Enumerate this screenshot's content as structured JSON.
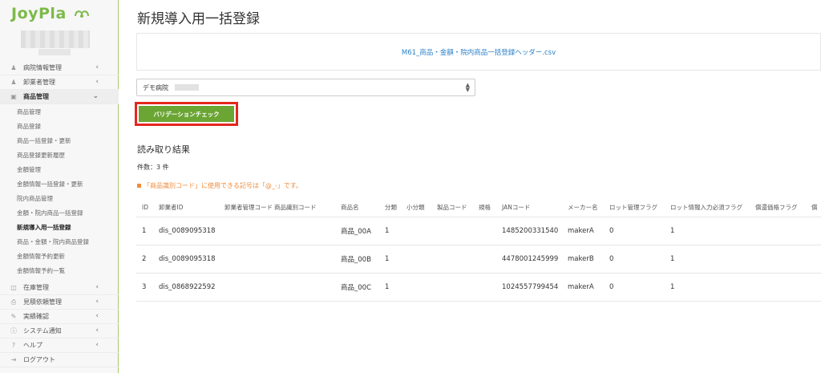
{
  "brand": {
    "logo_text": "JoyPla"
  },
  "sidebar": {
    "items": [
      {
        "label": "病院情報管理",
        "icon": "users-icon",
        "expanded": false
      },
      {
        "label": "卸業者管理",
        "icon": "users-icon",
        "expanded": false
      },
      {
        "label": "商品管理",
        "icon": "box-icon",
        "expanded": true
      }
    ],
    "sub_items": [
      "商品管理",
      "商品登録",
      "商品一括登録・更新",
      "商品登録更新履歴",
      "金額管理",
      "金額情報一括登録・更新",
      "院内商品管理",
      "金額・院内商品一括登録",
      "新規導入用一括登録",
      "商品・金額・院内商品登録",
      "金額情報予約更新",
      "金額情報予約一覧"
    ],
    "current_sub": "新規導入用一括登録",
    "bottom_items": [
      {
        "label": "在庫管理",
        "icon": "database-icon"
      },
      {
        "label": "見積依頼管理",
        "icon": "print-icon"
      },
      {
        "label": "実績確認",
        "icon": "edit-icon"
      },
      {
        "label": "システム通知",
        "icon": "info-icon"
      },
      {
        "label": "ヘルプ",
        "icon": "help-icon"
      },
      {
        "label": "ログアウト",
        "icon": "logout-icon"
      }
    ]
  },
  "main": {
    "title": "新規導入用一括登録",
    "file_name": "M61_商品・金額・院内商品一括登録ヘッダー.csv",
    "hospital_select": "デモ病院",
    "validate_button": "バリデーションチェック",
    "result_title": "読み取り結果",
    "count_text": "件数：3 件",
    "warning_text": "「商品識別コード」に使用できる記号は「@_-」です。"
  },
  "table": {
    "columns": [
      "ID",
      "卸業者ID",
      "卸業者管理コード",
      "商品識別コード",
      "商品名",
      "分類",
      "小分類",
      "製品コード",
      "規格",
      "JANコード",
      "メーカー名",
      "ロット管理フラグ",
      "ロット情報入力必須フラグ",
      "償還価格フラグ",
      "償"
    ],
    "rows": [
      [
        "1",
        "dis_0089095318",
        "",
        "",
        "商品_00A",
        "1",
        "",
        "",
        "",
        "1485200331540",
        "makerA",
        "0",
        "1",
        "",
        ""
      ],
      [
        "2",
        "dis_0089095318",
        "",
        "",
        "商品_00B",
        "1",
        "",
        "",
        "",
        "4478001245999",
        "makerB",
        "0",
        "1",
        "",
        ""
      ],
      [
        "3",
        "dis_0868922592",
        "",
        "",
        "商品_00C",
        "1",
        "",
        "",
        "",
        "1024557799454",
        "makerA",
        "0",
        "1",
        "",
        ""
      ]
    ]
  },
  "colors": {
    "accent_green": "#6ba533",
    "link_blue": "#2a7fc9",
    "warning_orange": "#f08c3c",
    "highlight_red": "#e4261f"
  }
}
